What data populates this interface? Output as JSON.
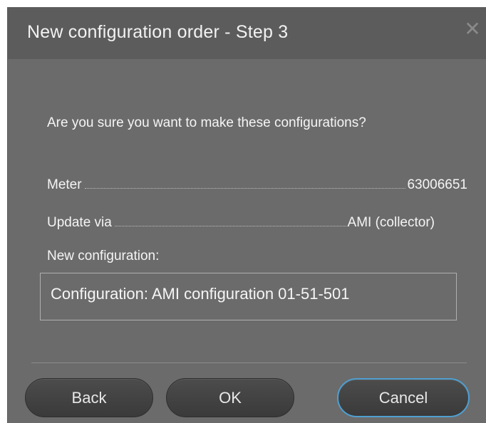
{
  "dialog": {
    "title": "New configuration order - Step 3",
    "close_icon": "close-icon",
    "question": "Are you sure you want to make these configurations?",
    "meter": {
      "label": "Meter",
      "value": "63006651"
    },
    "update_via": {
      "label": "Update via",
      "value": "AMI (collector)"
    },
    "new_configuration_label": "New configuration:",
    "configuration_text": "Configuration: AMI configuration 01-51-501"
  },
  "buttons": {
    "back": "Back",
    "ok": "OK",
    "cancel": "Cancel"
  },
  "colors": {
    "dialog_bg": "#6b6b6b",
    "titlebar_bg": "#5c5c5c",
    "button_bg": "#3f3f3f",
    "focus_accent": "#4f9fd0"
  }
}
